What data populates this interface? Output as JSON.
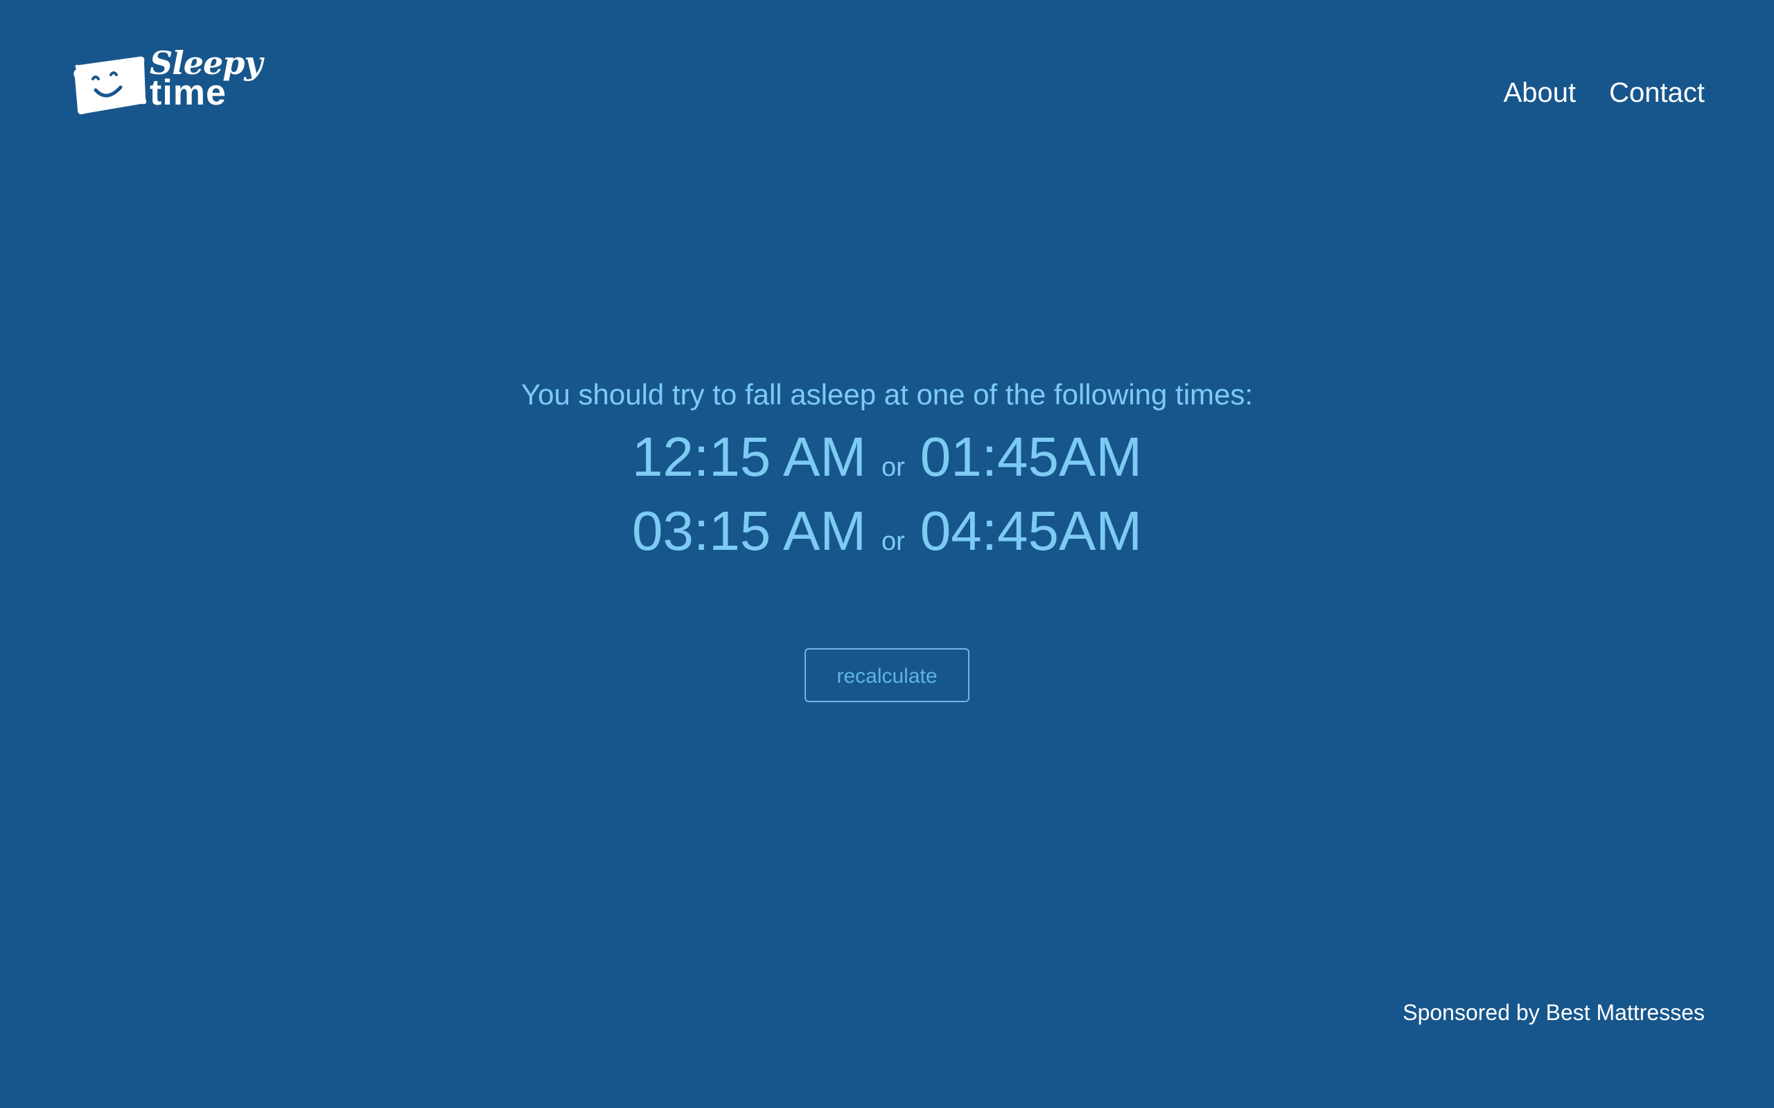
{
  "header": {
    "logo": {
      "word1": "Sleepy",
      "word2": "time",
      "icon": "pillow-smile-icon"
    },
    "nav": [
      {
        "label": "About"
      },
      {
        "label": "Contact"
      }
    ]
  },
  "main": {
    "headline": "You should try to fall asleep at one of the following times:",
    "times": [
      {
        "left": "12:15 AM",
        "sep": "or",
        "right": "01:45AM"
      },
      {
        "left": "03:15 AM",
        "sep": "or",
        "right": "04:45AM"
      }
    ],
    "button_label": "recalculate"
  },
  "footer": {
    "sponsor": "Sponsored by Best Mattresses"
  },
  "colors": {
    "background": "#17568c",
    "accent_text": "#7dcbf5",
    "button_border": "#6db6e6",
    "white": "#ffffff"
  }
}
